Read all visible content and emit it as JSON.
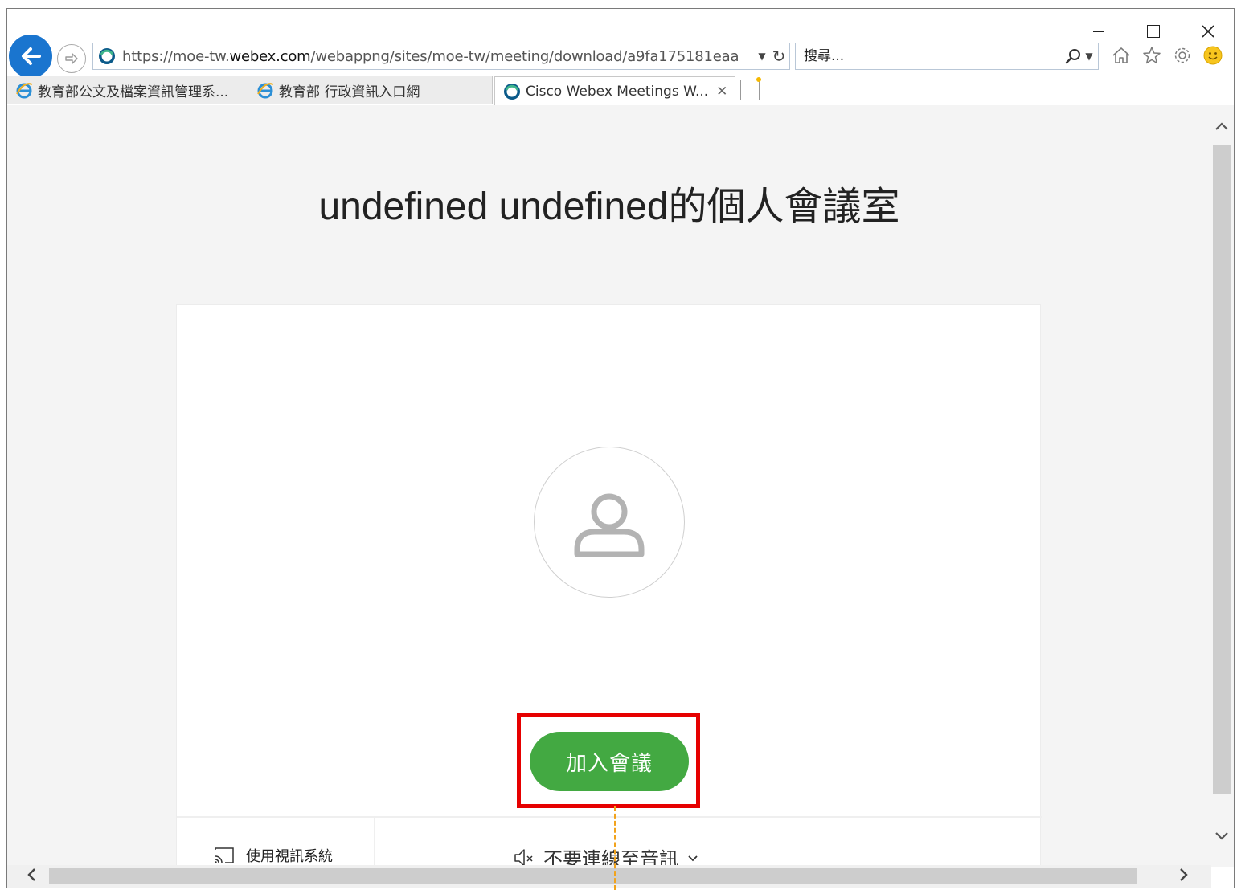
{
  "window_controls": {
    "minimize": "—",
    "maximize": "☐",
    "close": "✕"
  },
  "nav": {
    "back_icon": "back-arrow-icon",
    "forward_icon": "forward-arrow-icon"
  },
  "address": {
    "prefix": "https://moe-tw.",
    "domain": "webex.com",
    "path": "/webappng/sites/moe-tw/meeting/download/a9fa175181eaa"
  },
  "search": {
    "placeholder": "搜尋..."
  },
  "toolbar": {
    "icons": [
      "home-icon",
      "favorites-star-icon",
      "settings-gear-icon",
      "feedback-smiley-icon"
    ]
  },
  "tabs": [
    {
      "label": "教育部公文及檔案資訊管理系...",
      "active": false
    },
    {
      "label": "教育部 行政資訊入口網",
      "active": false
    },
    {
      "label": "Cisco Webex Meetings W...",
      "active": true
    }
  ],
  "page": {
    "title": "undefined undefined的個人會議室",
    "join_button": "加入會議",
    "video_system": "使用視訊系統",
    "audio_option": "不要連線至音訊"
  },
  "colors": {
    "join_green": "#43a942",
    "highlight_red": "#e60000",
    "back_blue": "#1a75cf"
  }
}
